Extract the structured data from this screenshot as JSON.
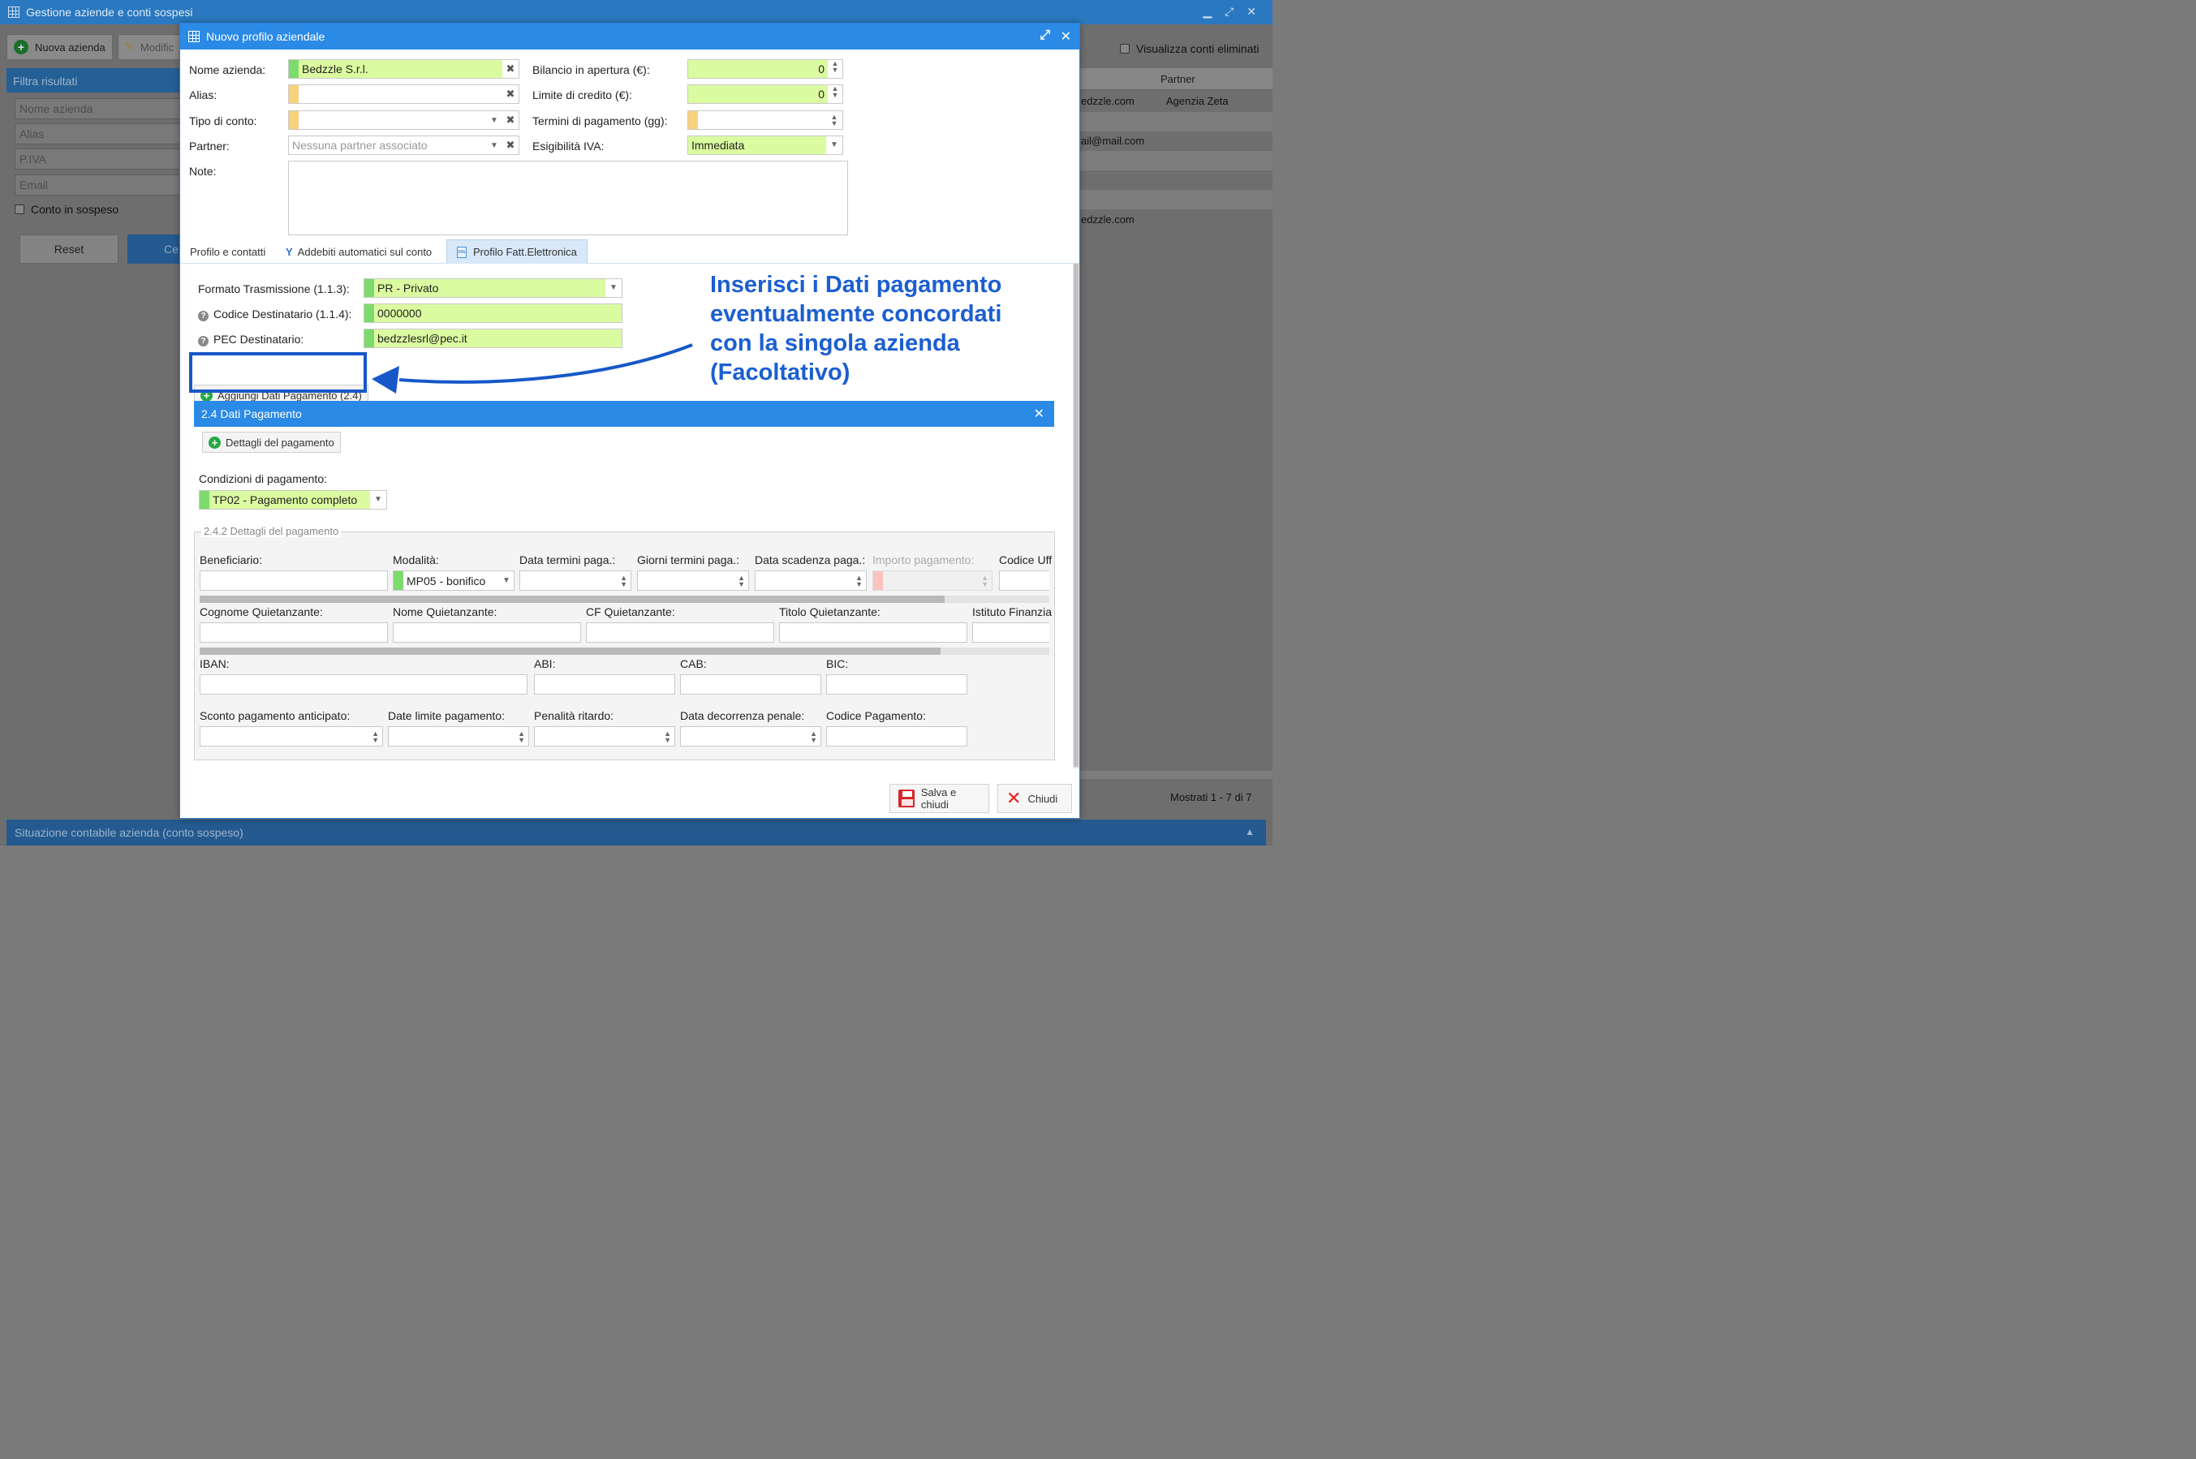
{
  "app": {
    "title": "Gestione aziende e conti sospesi",
    "toolbar": {
      "new_company": "Nuova azienda",
      "edit": "Modific"
    },
    "show_deleted_label": "Visualizza conti eliminati",
    "filter": {
      "title": "Filtra risultati",
      "name_placeholder": "Nome azienda",
      "alias_placeholder": "Alias",
      "vat_placeholder": "P.IVA",
      "email_placeholder": "Email",
      "suspended_label": "Conto in sospeso",
      "reset_label": "Reset",
      "search_label": "Ce"
    },
    "table": {
      "partner_header": "Partner",
      "rows": [
        {
          "email": "edzzle.com",
          "partner": "Agenzia Zeta"
        },
        {
          "email": "ail@mail.com",
          "partner": ""
        },
        {
          "email": "edzzle.com",
          "partner": ""
        }
      ],
      "pagination": "Mostrati 1 - 7 di 7"
    },
    "status_bar": "Situazione contabile azienda (conto sospeso)"
  },
  "dialog": {
    "title": "Nuovo profilo aziendale",
    "fields": {
      "company_name_label": "Nome azienda:",
      "company_name_value": "Bedzzle S.r.l.",
      "alias_label": "Alias:",
      "alias_value": "",
      "account_type_label": "Tipo di conto:",
      "account_type_value": "",
      "partner_label": "Partner:",
      "partner_placeholder": "Nessuna partner associato",
      "notes_label": "Note:",
      "opening_balance_label": "Bilancio in apertura (€):",
      "opening_balance_value": "0",
      "credit_limit_label": "Limite di credito (€):",
      "credit_limit_value": "0",
      "payment_terms_label": "Termini di pagamento (gg):",
      "payment_terms_value": "",
      "vat_label": "Esigibilità IVA:",
      "vat_value": "Immediata"
    },
    "tabs": [
      {
        "label": "Profilo e contatti"
      },
      {
        "label": "Addebiti automatici sul conto"
      },
      {
        "label": "Profilo Fatt.Elettronica"
      }
    ],
    "einvoice": {
      "format_label": "Formato Trasmissione (1.1.3):",
      "format_value": "PR - Privato",
      "recipient_code_label": "Codice Destinatario (1.1.4):",
      "recipient_code_value": "0000000",
      "pec_label": "PEC Destinatario:",
      "pec_value": "bedzzlesrl@pec.it",
      "add_payment_button": "Aggiungi Dati Pagamento (2.4)"
    },
    "payment_panel": {
      "title": "2.4 Dati Pagamento",
      "details_button": "Dettagli del pagamento",
      "conditions_label": "Condizioni di pagamento:",
      "conditions_value": "TP02 - Pagamento completo",
      "details_legend": "2.4.2 Dettagli del pagamento",
      "row1": {
        "beneficiary": "Beneficiario:",
        "mode": "Modalità:",
        "mode_value": "MP05 - bonifico",
        "terms_date": "Data termini paga.:",
        "terms_days": "Giorni termini paga.:",
        "due_date": "Data scadenza paga.:",
        "amount": "Importo pagamento:",
        "office_code": "Codice Uff"
      },
      "row2": {
        "surname": "Cognome Quietanzante:",
        "name": "Nome Quietanzante:",
        "cf": "CF Quietanzante:",
        "title": "Titolo Quietanzante:",
        "institute": "Istituto Finanzia"
      },
      "row3": {
        "iban": "IBAN:",
        "abi": "ABI:",
        "cab": "CAB:",
        "bic": "BIC:"
      },
      "row4": {
        "discount": "Sconto pagamento anticipato:",
        "deadline": "Date limite pagamento:",
        "penalty": "Penalità ritardo:",
        "penalty_date": "Data decorrenza penale:",
        "payment_code": "Codice Pagamento:"
      }
    },
    "footer": {
      "save_label": "Salva e chiudi",
      "close_label": "Chiudi"
    }
  },
  "annotation": {
    "text_line1": "Inserisci i Dati pagamento",
    "text_line2": "eventualmente concordati",
    "text_line3": "con la singola azienda",
    "text_line4": "(Facoltativo)",
    "color": "#1b5ed1"
  },
  "colors": {
    "accent": "#2b8ae6",
    "valid_field": "#dbfba0",
    "required_marker": "#f8d27a"
  }
}
